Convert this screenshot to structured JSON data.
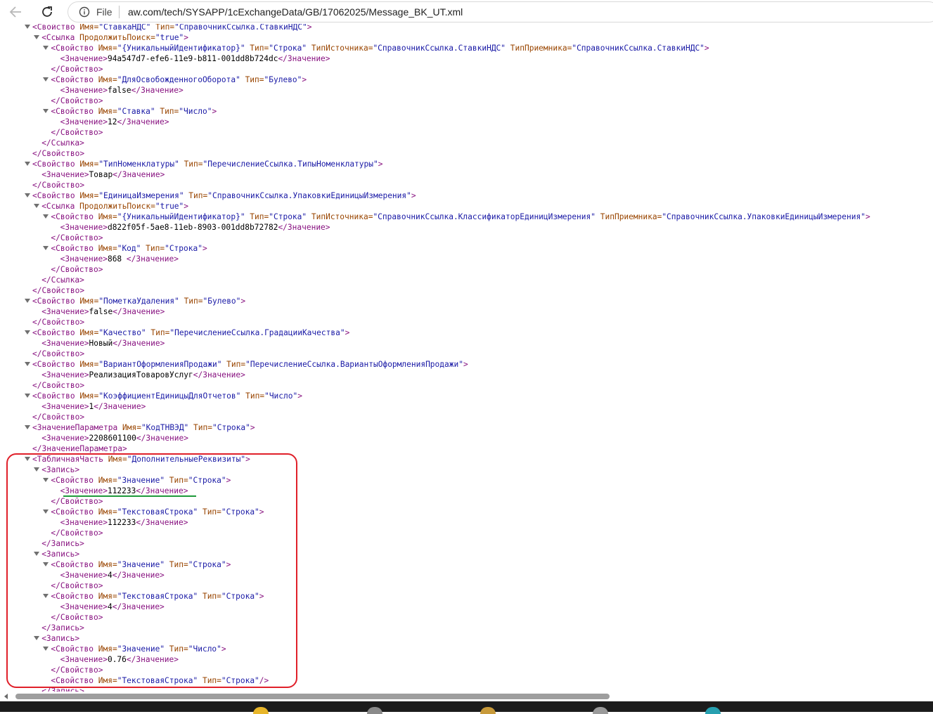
{
  "browser": {
    "scheme_label": "File",
    "url": "aw.com/tech/SYSAPP/1cExchangeData/GB/17062025/Message_BK_UT.xml"
  },
  "xml_lines": [
    {
      "d": 2,
      "t": 1,
      "s": [
        [
          "<Свойство ",
          ""
        ],
        [
          "Имя=",
          "an"
        ],
        [
          "\"СтавкаНДС\" ",
          "av"
        ],
        [
          "Тип=",
          "an"
        ],
        [
          "\"СправочникСсылка.СтавкиНДС\"",
          "av"
        ],
        [
          ">",
          ""
        ]
      ]
    },
    {
      "d": 3,
      "t": 1,
      "s": [
        [
          "<Ссылка ",
          ""
        ],
        [
          "ПродолжитьПоиск=",
          "an"
        ],
        [
          "\"true\"",
          "av"
        ],
        [
          ">",
          ""
        ]
      ]
    },
    {
      "d": 4,
      "t": 1,
      "s": [
        [
          "<Свойство ",
          ""
        ],
        [
          "Имя=",
          "an"
        ],
        [
          "\"{УникальныйИдентификатор}\" ",
          "av"
        ],
        [
          "Тип=",
          "an"
        ],
        [
          "\"Строка\" ",
          "av"
        ],
        [
          "ТипИсточника=",
          "an"
        ],
        [
          "\"СправочникСсылка.СтавкиНДС\" ",
          "av"
        ],
        [
          "ТипПриемника=",
          "an"
        ],
        [
          "\"СправочникСсылка.СтавкиНДС\"",
          "av"
        ],
        [
          ">",
          ""
        ]
      ]
    },
    {
      "d": 5,
      "t": 0,
      "s": [
        [
          "<Значение>",
          ""
        ],
        [
          "94a547d7-efe6-11e9-b811-001dd8b724dc",
          "tx"
        ],
        [
          "</Значение>",
          ""
        ]
      ]
    },
    {
      "d": 4,
      "t": 0,
      "s": [
        [
          "</Свойство>",
          ""
        ]
      ]
    },
    {
      "d": 4,
      "t": 1,
      "s": [
        [
          "<Свойство ",
          ""
        ],
        [
          "Имя=",
          "an"
        ],
        [
          "\"ДляОсвобожденногоОборота\" ",
          "av"
        ],
        [
          "Тип=",
          "an"
        ],
        [
          "\"Булево\"",
          "av"
        ],
        [
          ">",
          ""
        ]
      ]
    },
    {
      "d": 5,
      "t": 0,
      "s": [
        [
          "<Значение>",
          ""
        ],
        [
          "false",
          "tx"
        ],
        [
          "</Значение>",
          ""
        ]
      ]
    },
    {
      "d": 4,
      "t": 0,
      "s": [
        [
          "</Свойство>",
          ""
        ]
      ]
    },
    {
      "d": 4,
      "t": 1,
      "s": [
        [
          "<Свойство ",
          ""
        ],
        [
          "Имя=",
          "an"
        ],
        [
          "\"Ставка\" ",
          "av"
        ],
        [
          "Тип=",
          "an"
        ],
        [
          "\"Число\"",
          "av"
        ],
        [
          ">",
          ""
        ]
      ]
    },
    {
      "d": 5,
      "t": 0,
      "s": [
        [
          "<Значение>",
          ""
        ],
        [
          "12",
          "tx"
        ],
        [
          "</Значение>",
          ""
        ]
      ]
    },
    {
      "d": 4,
      "t": 0,
      "s": [
        [
          "</Свойство>",
          ""
        ]
      ]
    },
    {
      "d": 3,
      "t": 0,
      "s": [
        [
          "</Ссылка>",
          ""
        ]
      ]
    },
    {
      "d": 2,
      "t": 0,
      "s": [
        [
          "</Свойство>",
          ""
        ]
      ]
    },
    {
      "d": 2,
      "t": 1,
      "s": [
        [
          "<Свойство ",
          ""
        ],
        [
          "Имя=",
          "an"
        ],
        [
          "\"ТипНоменклатуры\" ",
          "av"
        ],
        [
          "Тип=",
          "an"
        ],
        [
          "\"ПеречислениеСсылка.ТипыНоменклатуры\"",
          "av"
        ],
        [
          ">",
          ""
        ]
      ]
    },
    {
      "d": 3,
      "t": 0,
      "s": [
        [
          "<Значение>",
          ""
        ],
        [
          "Товар",
          "tx"
        ],
        [
          "</Значение>",
          ""
        ]
      ]
    },
    {
      "d": 2,
      "t": 0,
      "s": [
        [
          "</Свойство>",
          ""
        ]
      ]
    },
    {
      "d": 2,
      "t": 1,
      "s": [
        [
          "<Свойство ",
          ""
        ],
        [
          "Имя=",
          "an"
        ],
        [
          "\"ЕдиницаИзмерения\" ",
          "av"
        ],
        [
          "Тип=",
          "an"
        ],
        [
          "\"СправочникСсылка.УпаковкиЕдиницыИзмерения\"",
          "av"
        ],
        [
          ">",
          ""
        ]
      ]
    },
    {
      "d": 3,
      "t": 1,
      "s": [
        [
          "<Ссылка ",
          ""
        ],
        [
          "ПродолжитьПоиск=",
          "an"
        ],
        [
          "\"true\"",
          "av"
        ],
        [
          ">",
          ""
        ]
      ]
    },
    {
      "d": 4,
      "t": 1,
      "s": [
        [
          "<Свойство ",
          ""
        ],
        [
          "Имя=",
          "an"
        ],
        [
          "\"{УникальныйИдентификатор}\" ",
          "av"
        ],
        [
          "Тип=",
          "an"
        ],
        [
          "\"Строка\" ",
          "av"
        ],
        [
          "ТипИсточника=",
          "an"
        ],
        [
          "\"СправочникСсылка.КлассификаторЕдиницИзмерения\" ",
          "av"
        ],
        [
          "ТипПриемника=",
          "an"
        ],
        [
          "\"СправочникСсылка.УпаковкиЕдиницыИзмерения\"",
          "av"
        ],
        [
          ">",
          ""
        ]
      ]
    },
    {
      "d": 5,
      "t": 0,
      "s": [
        [
          "<Значение>",
          ""
        ],
        [
          "d822f05f-5ae8-11eb-8903-001dd8b72782",
          "tx"
        ],
        [
          "</Значение>",
          ""
        ]
      ]
    },
    {
      "d": 4,
      "t": 0,
      "s": [
        [
          "</Свойство>",
          ""
        ]
      ]
    },
    {
      "d": 4,
      "t": 1,
      "s": [
        [
          "<Свойство ",
          ""
        ],
        [
          "Имя=",
          "an"
        ],
        [
          "\"Код\" ",
          "av"
        ],
        [
          "Тип=",
          "an"
        ],
        [
          "\"Строка\"",
          "av"
        ],
        [
          ">",
          ""
        ]
      ]
    },
    {
      "d": 5,
      "t": 0,
      "s": [
        [
          "<Значение>",
          ""
        ],
        [
          "868 ",
          "tx"
        ],
        [
          "</Значение>",
          ""
        ]
      ]
    },
    {
      "d": 4,
      "t": 0,
      "s": [
        [
          "</Свойство>",
          ""
        ]
      ]
    },
    {
      "d": 3,
      "t": 0,
      "s": [
        [
          "</Ссылка>",
          ""
        ]
      ]
    },
    {
      "d": 2,
      "t": 0,
      "s": [
        [
          "</Свойство>",
          ""
        ]
      ]
    },
    {
      "d": 2,
      "t": 1,
      "s": [
        [
          "<Свойство ",
          ""
        ],
        [
          "Имя=",
          "an"
        ],
        [
          "\"ПометкаУдаления\" ",
          "av"
        ],
        [
          "Тип=",
          "an"
        ],
        [
          "\"Булево\"",
          "av"
        ],
        [
          ">",
          ""
        ]
      ]
    },
    {
      "d": 3,
      "t": 0,
      "s": [
        [
          "<Значение>",
          ""
        ],
        [
          "false",
          "tx"
        ],
        [
          "</Значение>",
          ""
        ]
      ]
    },
    {
      "d": 2,
      "t": 0,
      "s": [
        [
          "</Свойство>",
          ""
        ]
      ]
    },
    {
      "d": 2,
      "t": 1,
      "s": [
        [
          "<Свойство ",
          ""
        ],
        [
          "Имя=",
          "an"
        ],
        [
          "\"Качество\" ",
          "av"
        ],
        [
          "Тип=",
          "an"
        ],
        [
          "\"ПеречислениеСсылка.ГрадацииКачества\"",
          "av"
        ],
        [
          ">",
          ""
        ]
      ]
    },
    {
      "d": 3,
      "t": 0,
      "s": [
        [
          "<Значение>",
          ""
        ],
        [
          "Новый",
          "tx"
        ],
        [
          "</Значение>",
          ""
        ]
      ]
    },
    {
      "d": 2,
      "t": 0,
      "s": [
        [
          "</Свойство>",
          ""
        ]
      ]
    },
    {
      "d": 2,
      "t": 1,
      "s": [
        [
          "<Свойство ",
          ""
        ],
        [
          "Имя=",
          "an"
        ],
        [
          "\"ВариантОформленияПродажи\" ",
          "av"
        ],
        [
          "Тип=",
          "an"
        ],
        [
          "\"ПеречислениеСсылка.ВариантыОформленияПродажи\"",
          "av"
        ],
        [
          ">",
          ""
        ]
      ]
    },
    {
      "d": 3,
      "t": 0,
      "s": [
        [
          "<Значение>",
          ""
        ],
        [
          "РеализацияТоваровУслуг",
          "tx"
        ],
        [
          "</Значение>",
          ""
        ]
      ]
    },
    {
      "d": 2,
      "t": 0,
      "s": [
        [
          "</Свойство>",
          ""
        ]
      ]
    },
    {
      "d": 2,
      "t": 1,
      "s": [
        [
          "<Свойство ",
          ""
        ],
        [
          "Имя=",
          "an"
        ],
        [
          "\"КоэффициентЕдиницыДляОтчетов\" ",
          "av"
        ],
        [
          "Тип=",
          "an"
        ],
        [
          "\"Число\"",
          "av"
        ],
        [
          ">",
          ""
        ]
      ]
    },
    {
      "d": 3,
      "t": 0,
      "s": [
        [
          "<Значение>",
          ""
        ],
        [
          "1",
          "tx"
        ],
        [
          "</Значение>",
          ""
        ]
      ]
    },
    {
      "d": 2,
      "t": 0,
      "s": [
        [
          "</Свойство>",
          ""
        ]
      ]
    },
    {
      "d": 2,
      "t": 1,
      "s": [
        [
          "<ЗначениеПараметра ",
          ""
        ],
        [
          "Имя=",
          "an"
        ],
        [
          "\"КодТНВЭД\" ",
          "av"
        ],
        [
          "Тип=",
          "an"
        ],
        [
          "\"Строка\"",
          "av"
        ],
        [
          ">",
          ""
        ]
      ]
    },
    {
      "d": 3,
      "t": 0,
      "s": [
        [
          "<Значение>",
          ""
        ],
        [
          "2208601100",
          "tx"
        ],
        [
          "</Значение>",
          ""
        ]
      ]
    },
    {
      "d": 2,
      "t": 0,
      "s": [
        [
          "</ЗначениеПараметра>",
          ""
        ]
      ]
    },
    {
      "d": 2,
      "t": 1,
      "s": [
        [
          "<ТабличнаяЧасть ",
          ""
        ],
        [
          "Имя=",
          "an"
        ],
        [
          "\"ДополнительныеРеквизиты\"",
          "av"
        ],
        [
          ">",
          ""
        ]
      ]
    },
    {
      "d": 3,
      "t": 1,
      "s": [
        [
          "<Запись>",
          ""
        ]
      ]
    },
    {
      "d": 4,
      "t": 1,
      "s": [
        [
          "<Свойство ",
          ""
        ],
        [
          "Имя=",
          "an"
        ],
        [
          "\"Значение\" ",
          "av"
        ],
        [
          "Тип=",
          "an"
        ],
        [
          "\"Строка\"",
          "av"
        ],
        [
          ">",
          ""
        ]
      ]
    },
    {
      "d": 5,
      "t": 0,
      "s": [
        [
          "<Значение>",
          ""
        ],
        [
          "112233",
          "tx"
        ],
        [
          "</Значение>",
          ""
        ]
      ]
    },
    {
      "d": 4,
      "t": 0,
      "s": [
        [
          "</Свойство>",
          ""
        ]
      ]
    },
    {
      "d": 4,
      "t": 1,
      "s": [
        [
          "<Свойство ",
          ""
        ],
        [
          "Имя=",
          "an"
        ],
        [
          "\"ТекстоваяСтрока\" ",
          "av"
        ],
        [
          "Тип=",
          "an"
        ],
        [
          "\"Строка\"",
          "av"
        ],
        [
          ">",
          ""
        ]
      ]
    },
    {
      "d": 5,
      "t": 0,
      "s": [
        [
          "<Значение>",
          ""
        ],
        [
          "112233",
          "tx"
        ],
        [
          "</Значение>",
          ""
        ]
      ]
    },
    {
      "d": 4,
      "t": 0,
      "s": [
        [
          "</Свойство>",
          ""
        ]
      ]
    },
    {
      "d": 3,
      "t": 0,
      "s": [
        [
          "</Запись>",
          ""
        ]
      ]
    },
    {
      "d": 3,
      "t": 1,
      "s": [
        [
          "<Запись>",
          ""
        ]
      ]
    },
    {
      "d": 4,
      "t": 1,
      "s": [
        [
          "<Свойство ",
          ""
        ],
        [
          "Имя=",
          "an"
        ],
        [
          "\"Значение\" ",
          "av"
        ],
        [
          "Тип=",
          "an"
        ],
        [
          "\"Строка\"",
          "av"
        ],
        [
          ">",
          ""
        ]
      ]
    },
    {
      "d": 5,
      "t": 0,
      "s": [
        [
          "<Значение>",
          ""
        ],
        [
          "4",
          "tx"
        ],
        [
          "</Значение>",
          ""
        ]
      ]
    },
    {
      "d": 4,
      "t": 0,
      "s": [
        [
          "</Свойство>",
          ""
        ]
      ]
    },
    {
      "d": 4,
      "t": 1,
      "s": [
        [
          "<Свойство ",
          ""
        ],
        [
          "Имя=",
          "an"
        ],
        [
          "\"ТекстоваяСтрока\" ",
          "av"
        ],
        [
          "Тип=",
          "an"
        ],
        [
          "\"Строка\"",
          "av"
        ],
        [
          ">",
          ""
        ]
      ]
    },
    {
      "d": 5,
      "t": 0,
      "s": [
        [
          "<Значение>",
          ""
        ],
        [
          "4",
          "tx"
        ],
        [
          "</Значение>",
          ""
        ]
      ]
    },
    {
      "d": 4,
      "t": 0,
      "s": [
        [
          "</Свойство>",
          ""
        ]
      ]
    },
    {
      "d": 3,
      "t": 0,
      "s": [
        [
          "</Запись>",
          ""
        ]
      ]
    },
    {
      "d": 3,
      "t": 1,
      "s": [
        [
          "<Запись>",
          ""
        ]
      ]
    },
    {
      "d": 4,
      "t": 1,
      "s": [
        [
          "<Свойство ",
          ""
        ],
        [
          "Имя=",
          "an"
        ],
        [
          "\"Значение\" ",
          "av"
        ],
        [
          "Тип=",
          "an"
        ],
        [
          "\"Число\"",
          "av"
        ],
        [
          ">",
          ""
        ]
      ]
    },
    {
      "d": 5,
      "t": 0,
      "s": [
        [
          "<Значение>",
          ""
        ],
        [
          "0.76",
          "tx"
        ],
        [
          "</Значение>",
          ""
        ]
      ]
    },
    {
      "d": 4,
      "t": 0,
      "s": [
        [
          "</Свойство>",
          ""
        ]
      ]
    },
    {
      "d": 4,
      "t": 0,
      "s": [
        [
          "<Свойство ",
          ""
        ],
        [
          "Имя=",
          "an"
        ],
        [
          "\"ТекстоваяСтрока\" ",
          "av"
        ],
        [
          "Тип=",
          "an"
        ],
        [
          "\"Строка\"",
          "av"
        ],
        [
          "/>",
          ""
        ]
      ]
    },
    {
      "d": 3,
      "t": 0,
      "s": [
        [
          "</Запись>",
          ""
        ]
      ]
    }
  ]
}
